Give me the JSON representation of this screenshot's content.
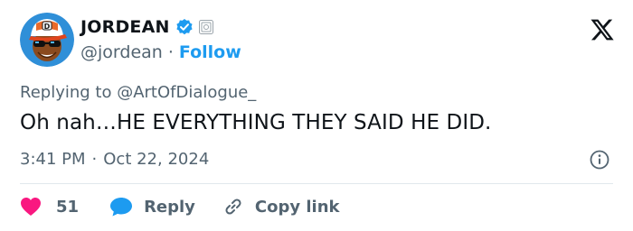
{
  "author": {
    "display_name": "JORDEAN",
    "handle": "@jordean",
    "separator": "·",
    "follow_label": "Follow"
  },
  "reply_context": {
    "prefix": "Replying to",
    "mention": "@ArtOfDialogue_"
  },
  "tweet": {
    "text": "Oh nah…HE EVERYTHING THEY SAID HE DID.",
    "time": "3:41 PM",
    "separator": "·",
    "date": "Oct 22, 2024"
  },
  "actions": {
    "like_count": "51",
    "reply_label": "Reply",
    "copy_link_label": "Copy link"
  },
  "colors": {
    "accent": "#1d9bf0",
    "like": "#f91880",
    "text": "#0f1419",
    "muted": "#536471"
  },
  "icons": [
    "verified-badge-icon",
    "affiliate-badge-icon",
    "x-logo-icon",
    "info-icon",
    "heart-icon",
    "reply-bubble-icon",
    "link-icon"
  ]
}
